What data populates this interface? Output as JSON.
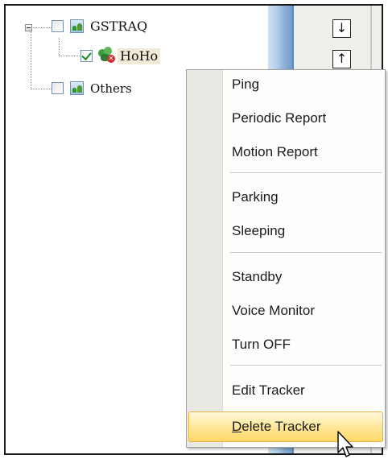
{
  "tree": {
    "nodes": [
      {
        "label": "GSTRAQ",
        "checked": false,
        "type": "group",
        "expanded": true
      },
      {
        "label": "HoHo",
        "checked": true,
        "type": "tracker",
        "selected": true
      },
      {
        "label": "Others",
        "checked": false,
        "type": "group"
      }
    ]
  },
  "map": {
    "buttons": [
      {
        "symbol": "↓"
      },
      {
        "symbol": "↑"
      }
    ]
  },
  "context_menu": {
    "items": [
      {
        "label": "Ping"
      },
      {
        "label": "Periodic Report"
      },
      {
        "label": "Motion Report"
      },
      {
        "label": "Parking"
      },
      {
        "label": "Sleeping"
      },
      {
        "label": "Standby"
      },
      {
        "label": "Voice Monitor"
      },
      {
        "label": "Turn OFF"
      },
      {
        "label": "Edit Tracker"
      },
      {
        "label": "Delete Tracker",
        "mnemonic": "D",
        "rest": "elete Tracker",
        "highlighted": true
      }
    ],
    "highlight_color": "#ffe79a"
  }
}
